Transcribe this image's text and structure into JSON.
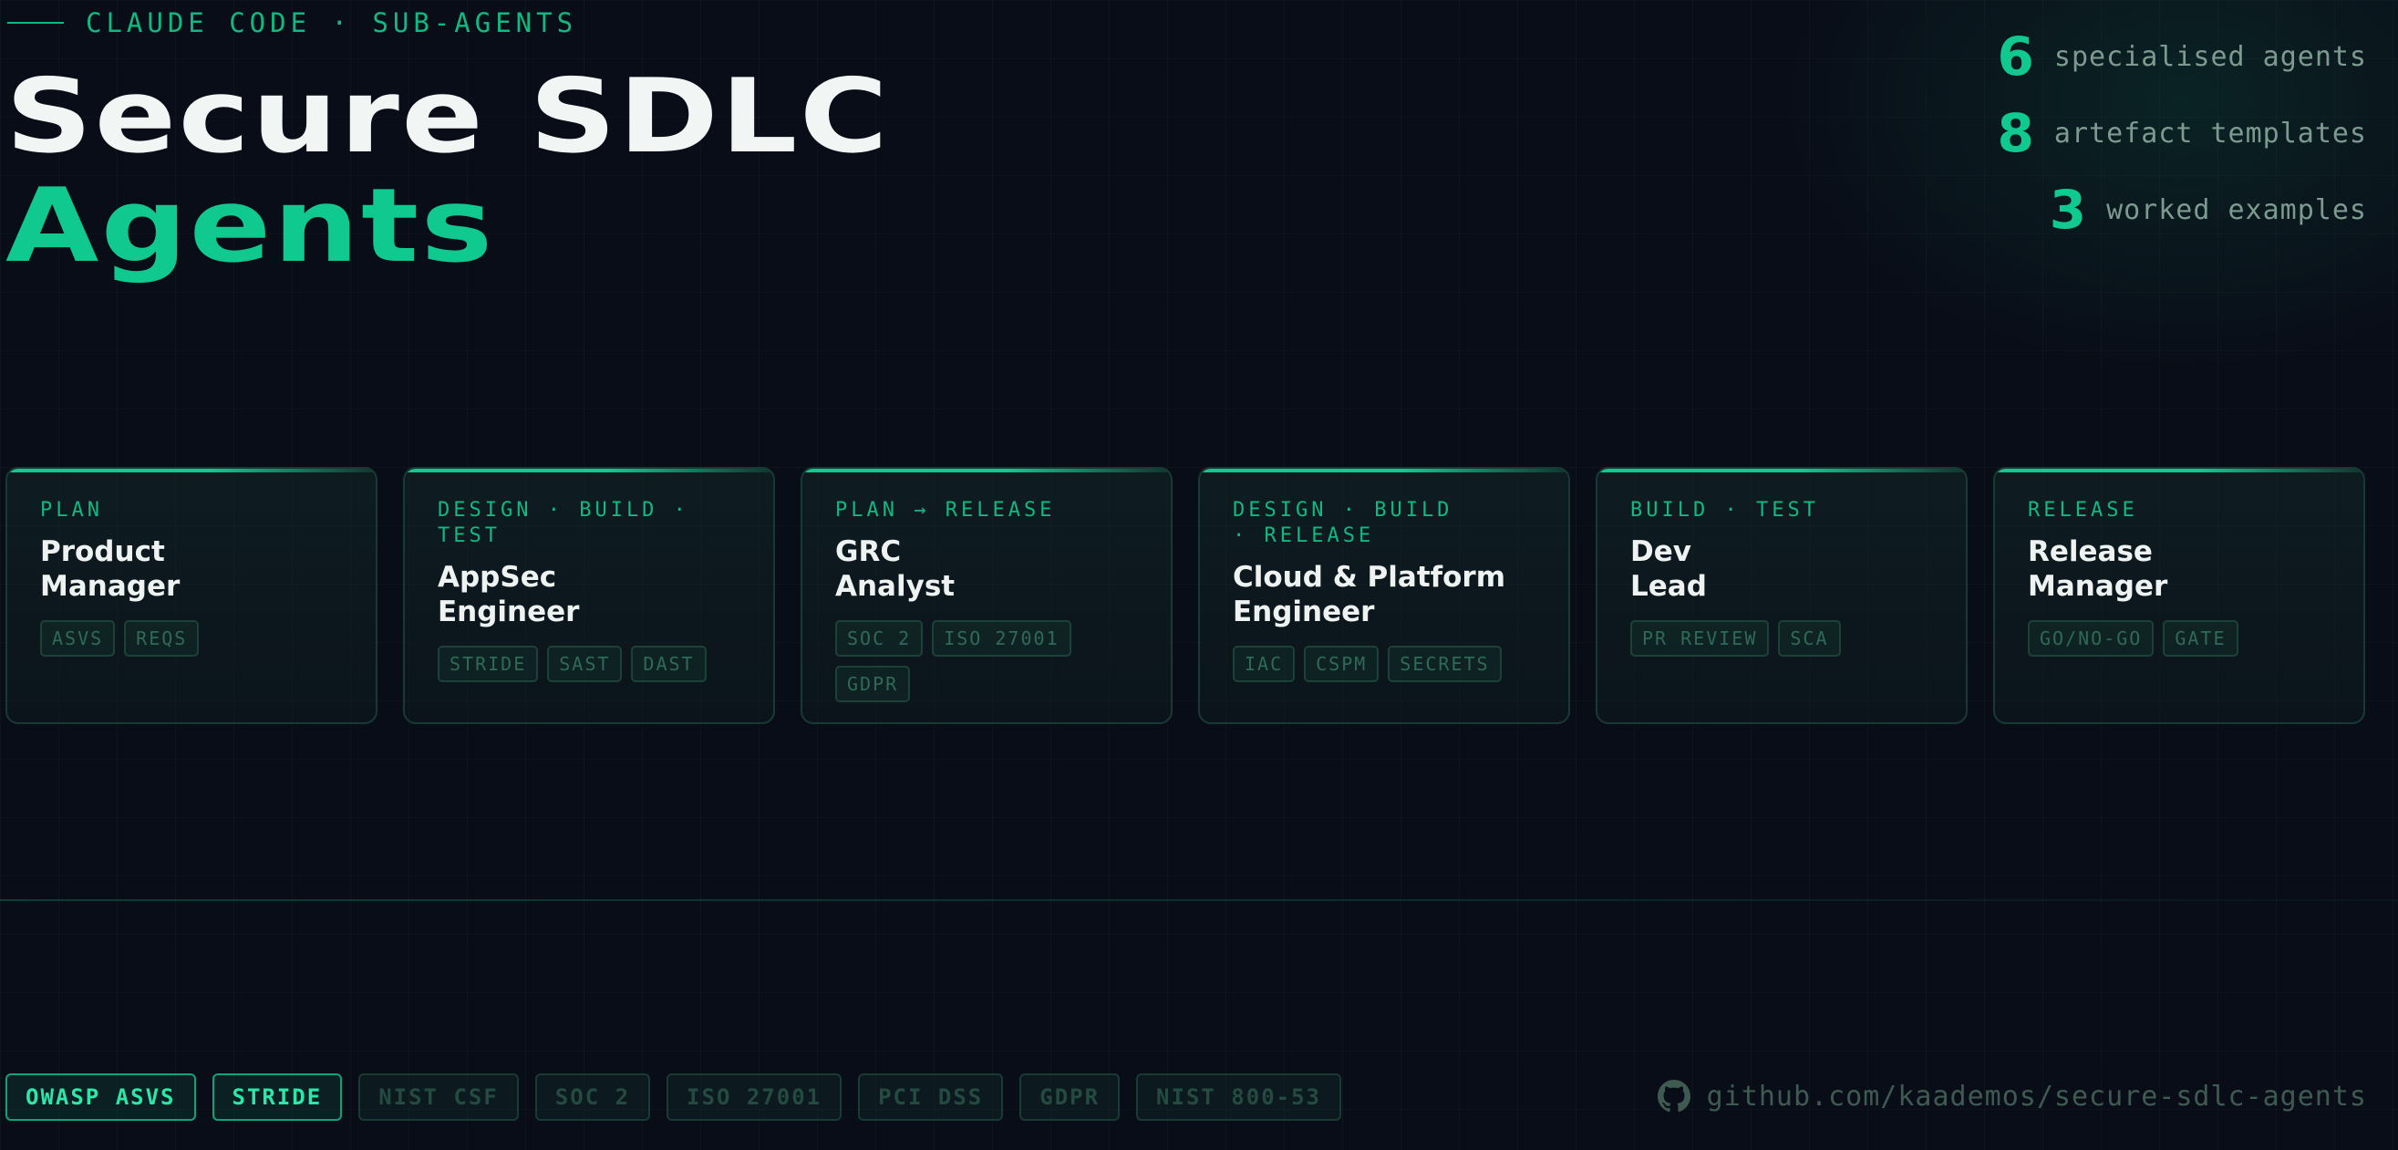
{
  "header": {
    "eyebrow": "CLAUDE CODE · SUB-AGENTS",
    "title_line1": "Secure SDLC",
    "title_line2": "Agents"
  },
  "stats": [
    {
      "value": "6",
      "label": "specialised agents"
    },
    {
      "value": "8",
      "label": "artefact templates"
    },
    {
      "value": "3",
      "label": "worked examples"
    }
  ],
  "agents": [
    {
      "phase": "PLAN",
      "role_line1": "Product",
      "role_line2": "Manager",
      "tags": [
        "ASVS",
        "REQS"
      ]
    },
    {
      "phase": "DESIGN · BUILD · TEST",
      "role_line1": "AppSec",
      "role_line2": "Engineer",
      "tags": [
        "STRIDE",
        "SAST",
        "DAST"
      ]
    },
    {
      "phase": "PLAN → RELEASE",
      "role_line1": "GRC",
      "role_line2": "Analyst",
      "tags": [
        "SOC 2",
        "ISO 27001",
        "GDPR"
      ]
    },
    {
      "phase": "DESIGN · BUILD · RELEASE",
      "role_line1": "Cloud & Platform",
      "role_line2": "Engineer",
      "tags": [
        "IAC",
        "CSPM",
        "SECRETS"
      ]
    },
    {
      "phase": "BUILD · TEST",
      "role_line1": "Dev",
      "role_line2": "Lead",
      "tags": [
        "PR REVIEW",
        "SCA"
      ]
    },
    {
      "phase": "RELEASE",
      "role_line1": "Release",
      "role_line2": "Manager",
      "tags": [
        "GO/NO-GO",
        "GATE"
      ]
    }
  ],
  "frameworks": [
    {
      "label": "OWASP ASVS",
      "active": true
    },
    {
      "label": "STRIDE",
      "active": true
    },
    {
      "label": "NIST CSF",
      "active": false
    },
    {
      "label": "SOC 2",
      "active": false
    },
    {
      "label": "ISO 27001",
      "active": false
    },
    {
      "label": "PCI DSS",
      "active": false
    },
    {
      "label": "GDPR",
      "active": false
    },
    {
      "label": "NIST 800-53",
      "active": false
    }
  ],
  "repo": {
    "icon": "github-icon",
    "text": "github.com/kaademos/secure-sdlc-agents"
  },
  "colors": {
    "background": "#090d17",
    "accent": "#10c98f",
    "title": "#f1f5f3",
    "muted": "#7d9a90"
  }
}
